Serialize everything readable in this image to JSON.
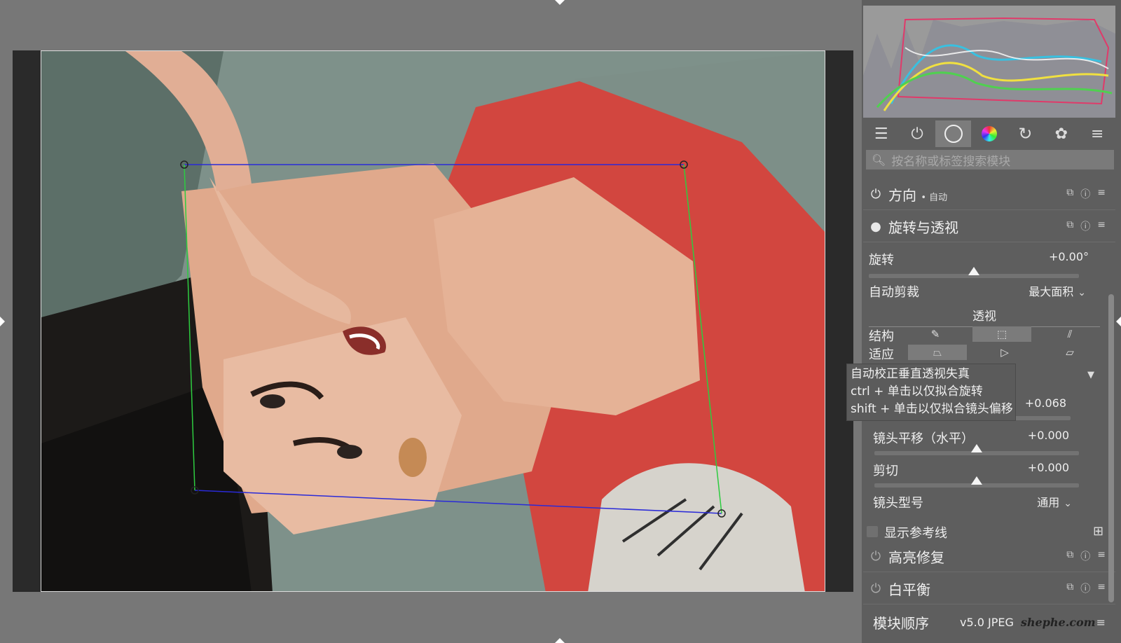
{
  "search": {
    "placeholder": "按名称或标签搜索模块"
  },
  "modules": {
    "orientation": {
      "name": "方向",
      "badge": "• 自动"
    },
    "rotate_perspective": {
      "name": "旋转与透视"
    },
    "highlight_recovery": {
      "name": "高亮修复"
    },
    "white_balance": {
      "name": "白平衡"
    }
  },
  "params": {
    "rotation": {
      "label": "旋转",
      "value": "+0.00°",
      "level": 0.5
    },
    "auto_crop": {
      "label": "自动剪裁",
      "value": "最大面积"
    },
    "perspective_section": "透视",
    "structure_label": "结构",
    "fit_label": "适应",
    "lens_vertical": {
      "value": "+0.068"
    },
    "lens_horizontal": {
      "label": "镜头平移（水平）",
      "value": "+0.000",
      "level": 0.5
    },
    "shear": {
      "label": "剪切",
      "value": "+0.000",
      "level": 0.5
    },
    "lens_model": {
      "label": "镜头型号",
      "value": "通用"
    },
    "show_guides": {
      "label": "显示参考线"
    }
  },
  "tooltip": {
    "line1": "自动校正垂直透视失真",
    "line2": "ctrl + 单击以仅拟合旋转",
    "line3": "shift + 单击以仅拟合镜头偏移"
  },
  "footer": {
    "label": "模块顺序",
    "version": "v5.0 JPEG",
    "watermark": "shephe.com"
  },
  "colors": {
    "accent_green": "#2ecc40",
    "accent_blue": "#2a2ad8",
    "dress_red": "#d44a43"
  },
  "icons": [
    "sliders-icon",
    "power-icon",
    "circle-icon",
    "color-wheel-icon",
    "refresh-icon",
    "palette-icon",
    "menu-icon"
  ]
}
